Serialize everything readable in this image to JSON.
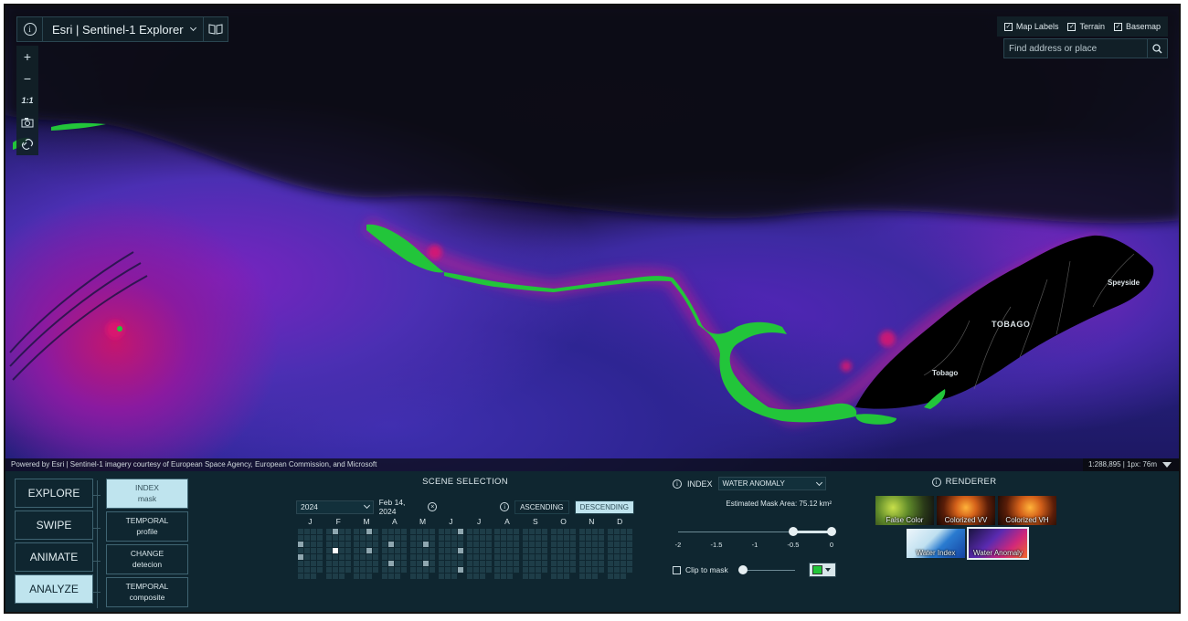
{
  "app": {
    "title": "Esri | Sentinel-1 Explorer"
  },
  "map_tools": {
    "zoom_in": "+",
    "zoom_out": "−",
    "scale_label": "1:1"
  },
  "layers": [
    {
      "label": "Map Labels",
      "checked": true
    },
    {
      "label": "Terrain",
      "checked": true
    },
    {
      "label": "Basemap",
      "checked": true
    }
  ],
  "search": {
    "placeholder": "Find address or place"
  },
  "map": {
    "attribution": "Powered by Esri | Sentinel-1 imagery courtesy of European Space Agency, European Commission, and Microsoft",
    "scale": "1:288,895 | 1px: 76m",
    "places": [
      "TOBAGO",
      "Speyside",
      "Tobago"
    ]
  },
  "modes": [
    {
      "label": "EXPLORE",
      "active": false
    },
    {
      "label": "SWIPE",
      "active": false
    },
    {
      "label": "ANIMATE",
      "active": false
    },
    {
      "label": "ANALYZE",
      "active": true
    }
  ],
  "analyze_tools": [
    {
      "line1": "INDEX",
      "line2": "mask",
      "active": true
    },
    {
      "line1": "TEMPORAL",
      "line2": "profile",
      "active": false
    },
    {
      "line1": "CHANGE",
      "line2": "detecion",
      "active": false
    },
    {
      "line1": "TEMPORAL",
      "line2": "composite",
      "active": false
    }
  ],
  "scene": {
    "title": "SCENE SELECTION",
    "year": "2024",
    "date": "Feb 14, 2024",
    "orbit_ascending": "ASCENDING",
    "orbit_descending": "DESCENDING",
    "active_orbit": "DESCENDING",
    "months": [
      "J",
      "F",
      "M",
      "A",
      "M",
      "J",
      "J",
      "A",
      "S",
      "O",
      "N",
      "D"
    ],
    "available_days": [
      [
        9,
        17
      ],
      [
        2,
        14
      ],
      [
        3,
        15
      ],
      [
        10,
        22
      ],
      [
        11,
        23
      ],
      [
        4,
        16,
        28
      ],
      [],
      [],
      [],
      [],
      [],
      []
    ],
    "selected": {
      "month": 1,
      "day": 14
    }
  },
  "index": {
    "label": "INDEX",
    "selected": "WATER ANOMALY",
    "mask_area": "Estimated Mask Area: 75.12 km²",
    "range": [
      -0.5,
      0
    ],
    "tick_labels": [
      "-2",
      "-1.5",
      "-1",
      "-0.5",
      "0"
    ],
    "clip_label": "Clip to mask",
    "clip_checked": false,
    "mask_color": "#22c53a"
  },
  "renderer": {
    "title": "RENDERER",
    "options": [
      {
        "label": "False Color",
        "selected": false
      },
      {
        "label": "Colorized VV",
        "selected": false
      },
      {
        "label": "Colorized VH",
        "selected": false
      },
      {
        "label": "Water Index",
        "selected": false
      },
      {
        "label": "Water Anomaly",
        "selected": true
      }
    ]
  },
  "colors": {
    "panel_bg": "#0f2630",
    "active_bg": "#bfe4ee",
    "mask_green": "#22c53a",
    "anomaly_magenta": "#c4166e"
  }
}
